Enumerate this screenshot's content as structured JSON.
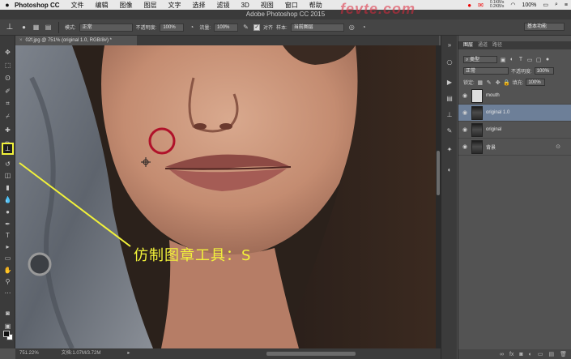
{
  "menubar": {
    "apple": "",
    "app": "Photoshop CC",
    "items": [
      "文件",
      "编辑",
      "图像",
      "图层",
      "文字",
      "选择",
      "滤镜",
      "3D",
      "视图",
      "窗口",
      "帮助"
    ],
    "net_up": "0.1KB/s",
    "net_down": "0.2KB/s",
    "battery": "100%"
  },
  "window": {
    "title": "Adobe Photoshop CC 2015",
    "watermark": "fevte.com"
  },
  "options": {
    "mode_label": "模式:",
    "mode_value": "正常",
    "opacity_label": "不透明度:",
    "opacity_value": "100%",
    "flow_label": "流量:",
    "flow_value": "100%",
    "aligned_label": "对齐",
    "sample_label": "样本:",
    "sample_value": "当前图层",
    "workspace": "基本功能"
  },
  "document": {
    "tab_title": "02f.jpg @ 751% (original 1.0, RGB/8#) *",
    "zoom": "751.22%",
    "doc_size": "文档:1.07M/3.72M"
  },
  "layers_panel": {
    "tabs": [
      "图层",
      "通道",
      "路径"
    ],
    "filter_label": "类型",
    "blend_mode": "正常",
    "opacity_label": "不透明度:",
    "opacity_value": "100%",
    "lock_label": "锁定:",
    "fill_label": "填充:",
    "fill_value": "100%",
    "layers": [
      {
        "name": "mouth",
        "selected": false,
        "thumb": "blank"
      },
      {
        "name": "original 1.0",
        "selected": true,
        "thumb": "photo"
      },
      {
        "name": "original",
        "selected": false,
        "thumb": "photo"
      },
      {
        "name": "背景",
        "selected": false,
        "thumb": "photo",
        "locked": true
      }
    ]
  },
  "annotation": {
    "text": "仿制图章工具：S",
    "color": "#f2f23a"
  },
  "colors": {
    "accent_selected_layer": "#6d7f98",
    "annotation": "#f2f23a",
    "brush_circle": "#b0122a"
  }
}
